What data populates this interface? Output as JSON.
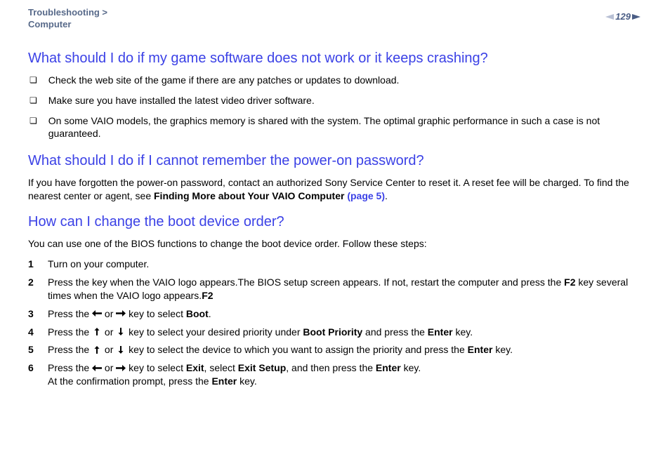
{
  "breadcrumb": {
    "line1": "Troubleshooting >",
    "line2": "Computer"
  },
  "page_number": "129",
  "section1": {
    "title": "What should I do if my game software does not work or it keeps crashing?",
    "bullets": [
      "Check the web site of the game if there are any patches or updates to download.",
      "Make sure you have installed the latest video driver software.",
      "On some VAIO models, the graphics memory is shared with the system. The optimal graphic performance in such a case is not guaranteed."
    ]
  },
  "section2": {
    "title": "What should I do if I cannot remember the power-on password?",
    "para_a": "If you have forgotten the power-on password, contact an authorized Sony Service Center to reset it. A reset fee will be charged. To find the nearest center or agent, see ",
    "para_bold": "Finding More about Your VAIO Computer ",
    "para_link": "(page 5)",
    "para_end": "."
  },
  "section3": {
    "title": "How can I change the boot device order?",
    "intro": "You can use one of the BIOS functions to change the boot device order. Follow these steps:",
    "steps": [
      {
        "n": "1",
        "t0": "Turn on your computer."
      },
      {
        "n": "2",
        "t0": "Press the ",
        "b1": "F2",
        "t1": " key when the VAIO logo appears.",
        "br": true,
        "t2": "The BIOS setup screen appears. If not, restart the computer and press the ",
        "b2": "F2",
        "t3": " key several times when the VAIO logo appears."
      },
      {
        "n": "3",
        "t0": "Press the ",
        "ar1": "left",
        "t1": " or ",
        "ar2": "right",
        "t2": " key to select ",
        "b1": "Boot",
        "t3": "."
      },
      {
        "n": "4",
        "t0": "Press the ",
        "ar1": "up",
        "t1": " or ",
        "ar2": "down",
        "t2": " key to select your desired priority under ",
        "b1": "Boot Priority",
        "t3": " and press the ",
        "b2": "Enter",
        "t4": " key."
      },
      {
        "n": "5",
        "t0": "Press the ",
        "ar1": "up",
        "t1": " or ",
        "ar2": "down",
        "t2": " key to select the device to which you want to assign the priority and press the ",
        "b1": "Enter",
        "t3": " key."
      },
      {
        "n": "6",
        "t0": "Press the ",
        "ar1": "left",
        "t1": " or ",
        "ar2": "right",
        "t2": " key to select ",
        "b1": "Exit",
        "t3": ", select ",
        "b2": "Exit Setup",
        "t4": ", and then press the ",
        "b3": "Enter",
        "t5": " key.",
        "br": true,
        "t6": "At the confirmation prompt, press the ",
        "b4": "Enter",
        "t7": " key."
      }
    ]
  }
}
